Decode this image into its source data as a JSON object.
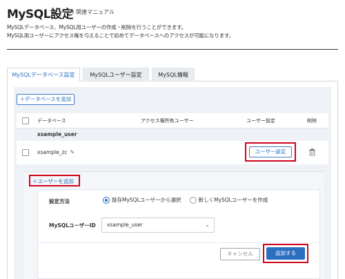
{
  "header": {
    "title": "MySQL設定",
    "manual_link": "関連マニュアル",
    "description_line1": "MySQLデータベース、MySQL用ユーザーの作成・削除を行うことができます。",
    "description_line2": "MySQL用ユーザーにアクセス権を与えることで初めてデータベースへのアクセスが可能になります。"
  },
  "tabs": [
    {
      "label": "MySQLデータベース設定",
      "active": true
    },
    {
      "label": "MySQLユーザー設定",
      "active": false
    },
    {
      "label": "MySQL情報",
      "active": false
    }
  ],
  "toolbar": {
    "add_database": "＋データベースを追加"
  },
  "table": {
    "columns": {
      "database": "データベース",
      "access_users": "アクセス権所有ユーザー",
      "user_settings": "ユーザー設定",
      "delete": "削除"
    },
    "group_label": "xsample_user",
    "row": {
      "name": "xsample_zc",
      "user_settings_button": "ユーザー設定"
    }
  },
  "add_user_panel": {
    "add_user_link": "＋ユーザーを追加",
    "method_label": "設定方法",
    "method_options": [
      "既存MySQLユーザーから選択",
      "新しくMySQLユーザーを作成"
    ],
    "selected_method": "既存MySQLユーザーから選択",
    "user_id_label": "MySQLユーザーID",
    "user_id_value": "xsample_user",
    "cancel_button": "キャンセル",
    "add_button": "追加する"
  },
  "colors": {
    "accent": "#2a6fc0",
    "highlight": "#d0021b"
  }
}
